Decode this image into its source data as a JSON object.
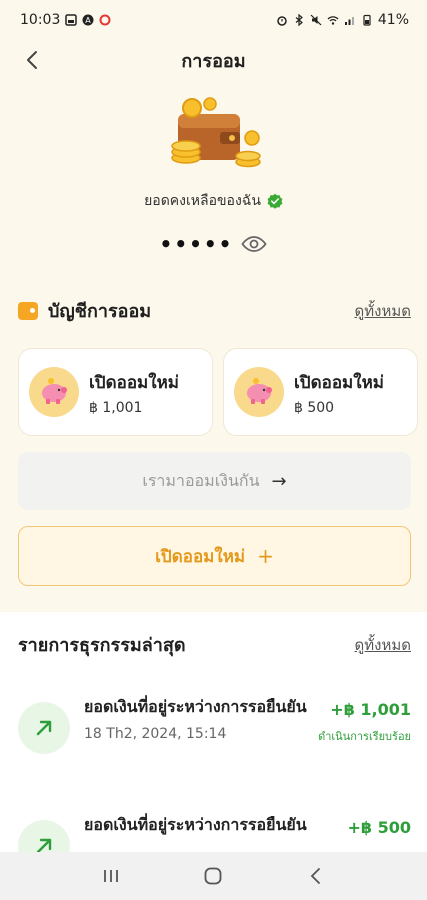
{
  "status_bar": {
    "time": "10:03",
    "battery": "41%"
  },
  "header": {
    "title": "การออม"
  },
  "hero": {
    "balance_label": "ยอดคงเหลือของฉัน",
    "masked_balance": "•••••"
  },
  "savings": {
    "title": "บัญชีการออม",
    "see_all": "ดูทั้งหมด",
    "accounts": [
      {
        "name": "เปิดออมใหม่",
        "amount": "฿ 1,001"
      },
      {
        "name": "เปิดออมใหม่",
        "amount": "฿ 500"
      }
    ]
  },
  "promo": {
    "label": "เรามาออมเงินกัน",
    "arrow": "→"
  },
  "open_new": {
    "label": "เปิดออมใหม่",
    "plus": "+"
  },
  "transactions": {
    "title": "รายการธุรกรรมล่าสุด",
    "see_all": "ดูทั้งหมด",
    "items": [
      {
        "title": "ยอดเงินที่อยู่ระหว่างการรอยืนยัน",
        "date": "18 Th2, 2024, 15:14",
        "amount": "+฿ 1,001",
        "status": "ดำเนินการเรียบร้อย"
      },
      {
        "title": "ยอดเงินที่อยู่ระหว่างการรอยืนยัน",
        "date": "",
        "amount": "+฿ 500",
        "status": ""
      }
    ]
  },
  "colors": {
    "accent": "#e39a1c",
    "positive": "#2e9e3a",
    "background": "#fdf8ec"
  }
}
